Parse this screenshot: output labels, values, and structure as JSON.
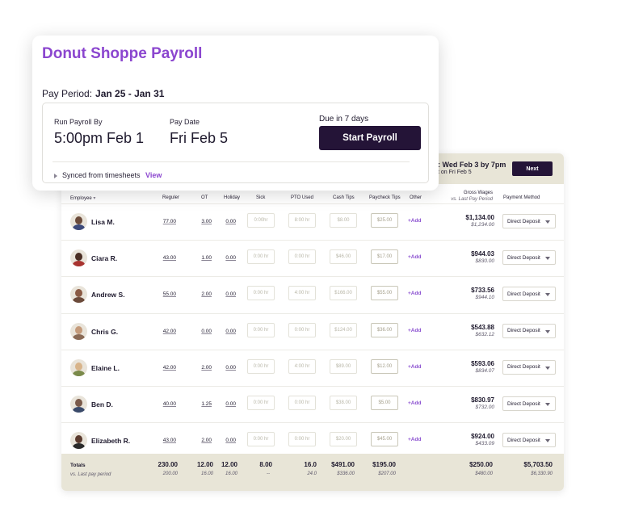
{
  "front_card": {
    "title": "Donut Shoppe Payroll",
    "pay_period_label": "Pay Period:",
    "pay_period_value": "Jan 25 - Jan 31",
    "run_by_label": "Run Payroll By",
    "run_by_value": "5:00pm Feb 1",
    "pay_date_label": "Pay Date",
    "pay_date_value": "Fri Feb 5",
    "due_text": "Due in 7 days",
    "start_button": "Start Payroll",
    "sync_text": "Synced from timesheets",
    "view_link": "View"
  },
  "deadline": {
    "text": ": Wed Feb 3 by 7pm",
    "sub": "t on Fri Feb 5",
    "next_button": "Next"
  },
  "columns": {
    "employee": "Employee",
    "employee_sort": "▾",
    "regular": "Reguler",
    "ot": "OT",
    "holiday": "Holiday",
    "sick": "Sick",
    "pto": "PTO Used",
    "cash_tips": "Cash Tips",
    "paycheck_tips": "Paycheck Tips",
    "other": "Other",
    "gross": "Gross Wages",
    "gross_sub": "vs. Last Pay Period",
    "payment": "Payment Method"
  },
  "employees": [
    {
      "name": "Lisa M.",
      "regular": "77.00",
      "ot": "3.00",
      "holiday": "0.00",
      "sick": "0:00hr",
      "pto": "8:00 hr",
      "cash": "$8.00",
      "paycheck": "$25.00",
      "add": "+Add",
      "gross": "$1,134.00",
      "gross_prev": "$1,234.00",
      "method": "Direct Deposit",
      "skin": "#6b4a3a",
      "shirt": "#3d4a7a"
    },
    {
      "name": "Ciara R.",
      "regular": "43.00",
      "ot": "1.00",
      "holiday": "0.00",
      "sick": "0:00 hr",
      "pto": "0:00 hr",
      "cash": "$46.00",
      "paycheck": "$17.00",
      "add": "+Add",
      "gross": "$944.03",
      "gross_prev": "$830.00",
      "method": "Direct Deposit",
      "skin": "#4a2e24",
      "shirt": "#a8332f"
    },
    {
      "name": "Andrew S.",
      "regular": "55.00",
      "ot": "2.00",
      "holiday": "0.00",
      "sick": "0:00 hr",
      "pto": "4:00 hr",
      "cash": "$166.00",
      "paycheck": "$55.00",
      "add": "+Add",
      "gross": "$733.56",
      "gross_prev": "$944.10",
      "method": "Direct Deposit",
      "skin": "#8a5a44",
      "shirt": "#6b4a3a"
    },
    {
      "name": "Chris G.",
      "regular": "42.00",
      "ot": "0.00",
      "holiday": "0.00",
      "sick": "0:00 hr",
      "pto": "0:00 hr",
      "cash": "$124.00",
      "paycheck": "$36.00",
      "add": "+Add",
      "gross": "$543.88",
      "gross_prev": "$632.12",
      "method": "Direct Deposit",
      "skin": "#c49a7a",
      "shirt": "#8a6a55"
    },
    {
      "name": "Elaine L.",
      "regular": "42.00",
      "ot": "2.00",
      "holiday": "0.00",
      "sick": "0:00 hr",
      "pto": "4:00 hr",
      "cash": "$89.00",
      "paycheck": "$12.00",
      "add": "+Add",
      "gross": "$593.06",
      "gross_prev": "$834.07",
      "method": "Direct Deposit",
      "skin": "#d8b48a",
      "shirt": "#7a8a4a"
    },
    {
      "name": "Ben D.",
      "regular": "40.00",
      "ot": "1.25",
      "holiday": "0.00",
      "sick": "0:00 hr",
      "pto": "0:00 hr",
      "cash": "$38.00",
      "paycheck": "$5.00",
      "add": "+Add",
      "gross": "$830.97",
      "gross_prev": "$732.00",
      "method": "Direct Deposit",
      "skin": "#7a5a4a",
      "shirt": "#3a4a6a"
    },
    {
      "name": "Elizabeth R.",
      "regular": "43.00",
      "ot": "2.00",
      "holiday": "0.00",
      "sick": "0:00 hr",
      "pto": "0:00 hr",
      "cash": "$20.00",
      "paycheck": "$45.00",
      "add": "+Add",
      "gross": "$924.00",
      "gross_prev": "$433.09",
      "method": "Direct Deposit",
      "skin": "#5a3a2e",
      "shirt": "#2a2a2a"
    }
  ],
  "totals": {
    "label": "Totals",
    "sub": "vs. Last pay period",
    "regular": "230.00",
    "ot": "12.00",
    "holiday": "12.00",
    "sick": "8.00",
    "pto": "16.0",
    "cash": "$491.00",
    "paycheck": "$195.00",
    "gross": "$250.00",
    "method": "$5,703.50",
    "prev_regular": "200.00",
    "prev_ot": "16.00",
    "prev_holiday": "16.00",
    "prev_sick": "--",
    "prev_pto": "24.0",
    "prev_cash": "$336.00",
    "prev_paycheck": "$207.00",
    "prev_gross": "$480.00",
    "prev_method": "$6,330.90"
  }
}
